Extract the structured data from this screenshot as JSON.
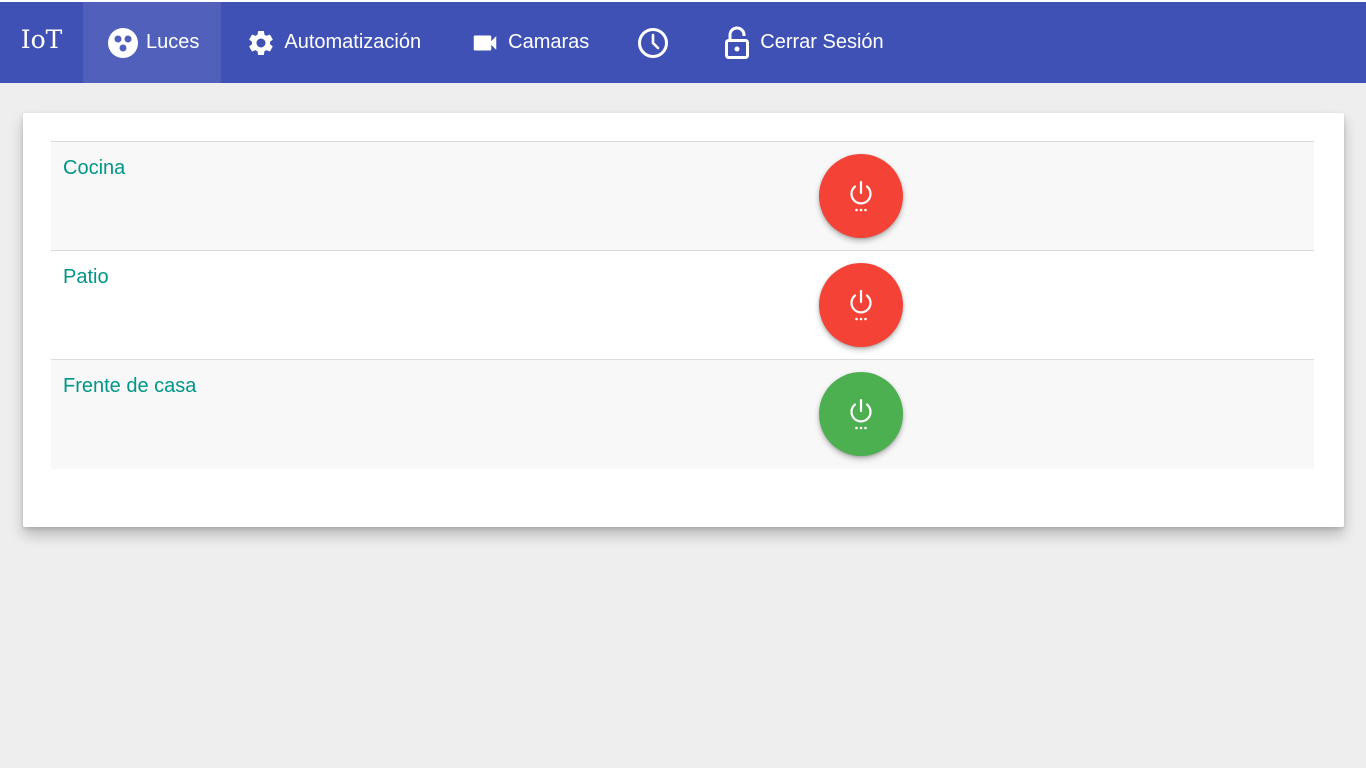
{
  "navbar": {
    "brand": "IoT",
    "background": "#3f51b5",
    "items": [
      {
        "label": "Luces",
        "icon": "lights-icon",
        "active": true
      },
      {
        "label": "Automatización",
        "icon": "gear-icon",
        "active": false
      },
      {
        "label": "Camaras",
        "icon": "videocam-icon",
        "active": false
      },
      {
        "label": "",
        "icon": "clock-icon",
        "active": false
      },
      {
        "label": "Cerrar Sesión",
        "icon": "lock-open-icon",
        "active": false
      }
    ]
  },
  "lights": {
    "label_color": "#009688",
    "items": [
      {
        "name": "Cocina",
        "state": "off",
        "button_color": "#f44336",
        "button_icon": "power-icon"
      },
      {
        "name": "Patio",
        "state": "off",
        "button_color": "#f44336",
        "button_icon": "power-icon"
      },
      {
        "name": "Frente de casa",
        "state": "on",
        "button_color": "#4caf50",
        "button_icon": "power-icon"
      }
    ]
  }
}
